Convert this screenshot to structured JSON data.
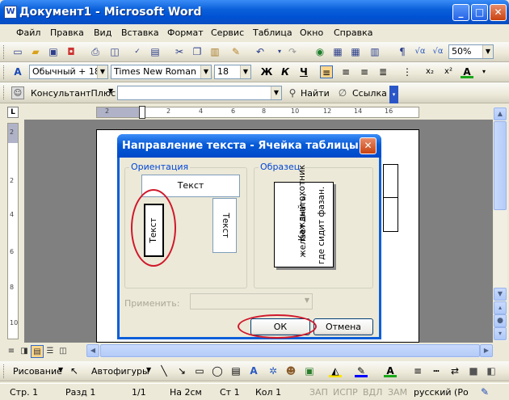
{
  "window": {
    "title": "Документ1 - Microsoft Word",
    "app_icon": "W",
    "minimize": "_",
    "maximize": "□",
    "close": "✕"
  },
  "menu": [
    "Файл",
    "Правка",
    "Вид",
    "Вставка",
    "Формат",
    "Сервис",
    "Таблица",
    "Окно",
    "Справка"
  ],
  "toolbar_standard": {
    "zoom": "50%"
  },
  "toolbar_format": {
    "style": "Обычный + 18 г",
    "font": "Times New Roman",
    "size": "18",
    "bold": "Ж",
    "italic": "К",
    "underline": "Ч"
  },
  "toolbar_consultant": {
    "name": "КонсультантПлюс",
    "find": "Найти",
    "link": "Ссылка"
  },
  "ruler_h": [
    "2",
    "2",
    "4",
    "6",
    "8",
    "10",
    "12",
    "14",
    "16"
  ],
  "ruler_v": [
    "2",
    "2",
    "4",
    "6",
    "8",
    "10"
  ],
  "dialog": {
    "title": "Направление текста - Ячейка таблицы",
    "orientation_label": "Ориентация",
    "sample_label": "Образец",
    "opt_horizontal": "Текст",
    "opt_up": "Текст",
    "opt_down": "Текст",
    "sample_lines": [
      "Каждый охотник",
      "желает знать,",
      "где сидит фазан."
    ],
    "apply_label": "Применить:",
    "ok": "ОК",
    "cancel": "Отмена"
  },
  "drawing_toolbar": {
    "drawing": "Рисование",
    "autoshapes": "Автофигуры"
  },
  "status": {
    "page": "Стр. 1",
    "section": "Разд 1",
    "pages": "1/1",
    "at": "На 2см",
    "line": "Ст 1",
    "col": "Кол 1",
    "rec": "ЗАП",
    "trk": "ИСПР",
    "ext": "ВДЛ",
    "ovr": "ЗАМ",
    "lang": "русский (Ро"
  }
}
